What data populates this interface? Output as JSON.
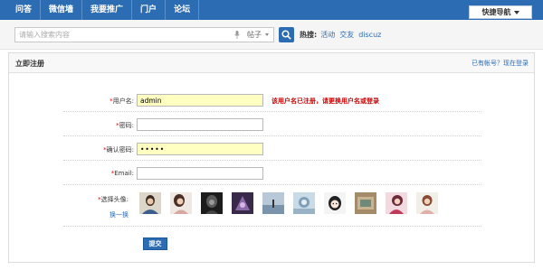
{
  "nav": {
    "items": [
      {
        "label": "问答"
      },
      {
        "label": "微信墙"
      },
      {
        "label": "我要推广"
      },
      {
        "label": "门户"
      },
      {
        "label": "论坛"
      }
    ],
    "quick_nav_label": "快捷导航"
  },
  "search": {
    "placeholder": "请输入搜索内容",
    "type_label": "帖子",
    "hot_label": "热搜:",
    "hot_links": [
      "活动",
      "交友",
      "discuz"
    ]
  },
  "panel": {
    "title": "立即注册",
    "login_link": "已有帐号？现在登录"
  },
  "form": {
    "username": {
      "label": "用户名:",
      "value": "admin"
    },
    "error": {
      "prefix": "该用户名已注册，请更换用户名或",
      "link": "登录"
    },
    "password": {
      "label": "密码:",
      "value": ""
    },
    "confirm_password": {
      "label": "确认密码:",
      "value": "•••••"
    },
    "email": {
      "label": "Email:",
      "value": ""
    },
    "avatar": {
      "label": "选择头像:",
      "change_label": "换一换"
    },
    "submit_label": "提交"
  },
  "colors": {
    "brand": "#2b6cb3",
    "error": "#cc0000",
    "required": "#ee0000",
    "highlight_field": "#ffffc2"
  }
}
